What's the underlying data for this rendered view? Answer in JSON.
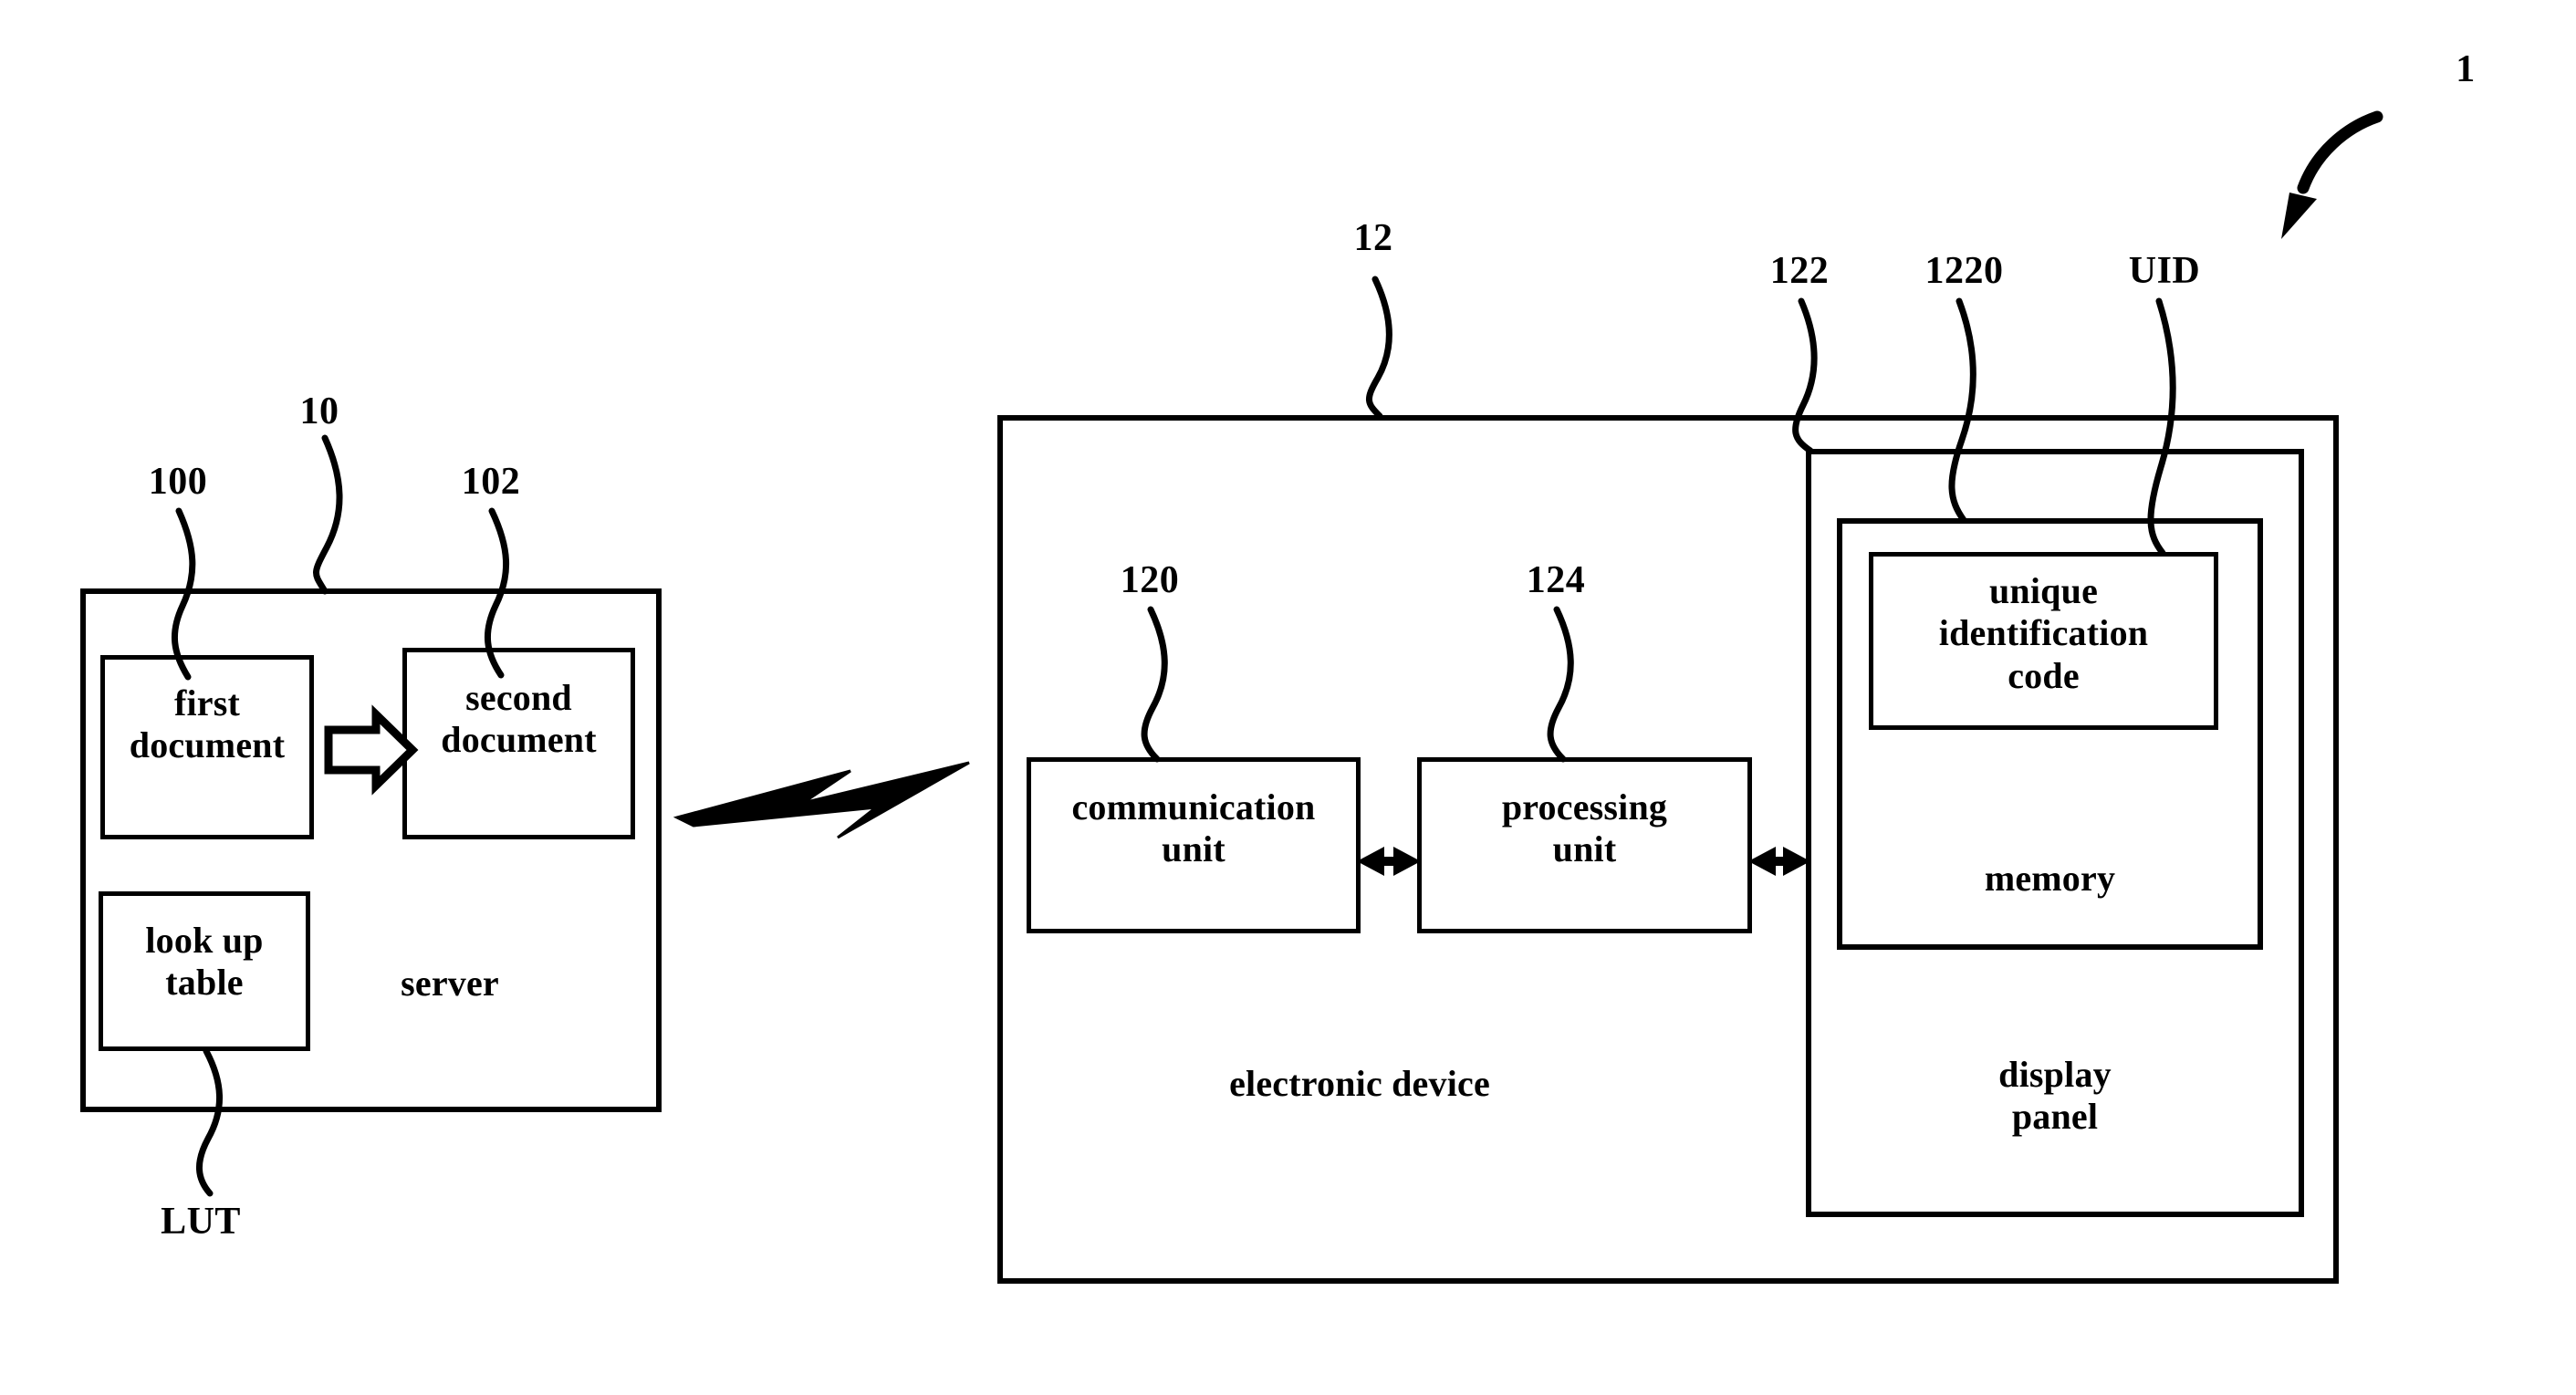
{
  "figure": {
    "number": "1",
    "system_label": "1"
  },
  "server": {
    "ref": "10",
    "label": "server",
    "first_document": {
      "ref": "100",
      "label": "first\ndocument"
    },
    "second_document": {
      "ref": "102",
      "label": "second\ndocument"
    },
    "look_up_table": {
      "ref": "LUT",
      "label": "look up\ntable"
    },
    "transform_arrow": "hollow-right-arrow"
  },
  "link": {
    "icon": "lightning-bolt-wireless-icon"
  },
  "electronic_device": {
    "ref": "12",
    "label": "electronic device",
    "communication_unit": {
      "ref": "120",
      "label": "communication\nunit"
    },
    "processing_unit": {
      "ref": "124",
      "label": "processing\nunit"
    },
    "display_panel": {
      "ref": "122",
      "label": "display\npanel"
    },
    "memory": {
      "ref": "1220",
      "label": "memory"
    },
    "unique_identification_code": {
      "ref": "UID",
      "label": "unique\nidentification\ncode"
    },
    "bus_arrows": [
      "double-headed-arrow",
      "double-headed-arrow"
    ]
  },
  "colors": {
    "ink": "#000000",
    "background": "#ffffff"
  }
}
